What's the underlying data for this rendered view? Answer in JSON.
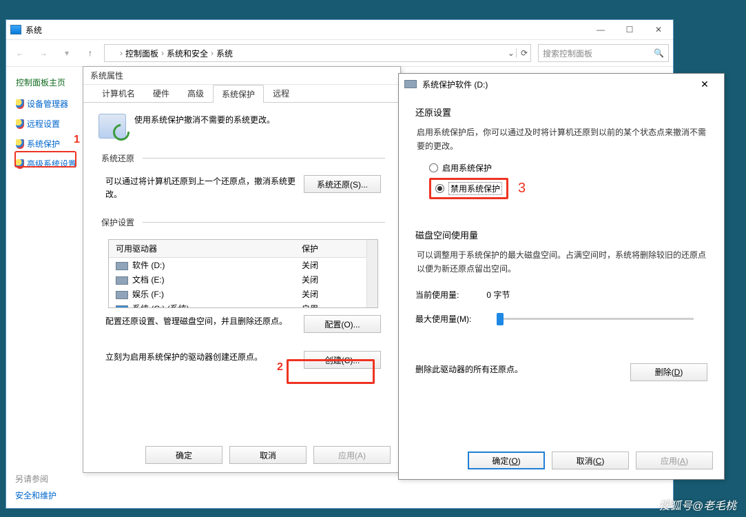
{
  "syswin": {
    "title": "系统",
    "breadcrumb": {
      "root": "控制面板",
      "cat": "系统和安全",
      "page": "系统"
    },
    "search_placeholder": "搜索控制面板",
    "left_heading": "控制面板主页",
    "links": {
      "devmgr": "设备管理器",
      "remote": "远程设置",
      "sysprot": "系统保护",
      "advanced": "高级系统设置"
    },
    "seealso": "另请参阅",
    "security": "安全和维护"
  },
  "annotations": {
    "a1": "1",
    "a2": "2",
    "a3": "3"
  },
  "propdlg": {
    "title": "系统属性",
    "tabs": {
      "computer": "计算机名",
      "hardware": "硬件",
      "advanced": "高级",
      "sysprot": "系统保护",
      "remote": "远程"
    },
    "intro": "使用系统保护撤消不需要的系统更改。",
    "grp_restore": "系统还原",
    "restore_text": "可以通过将计算机还原到上一个还原点，撤消系统更改。",
    "btn_restore": "系统还原(S)...",
    "grp_settings": "保护设置",
    "table": {
      "col_drive": "可用驱动器",
      "col_status": "保护",
      "rows": [
        {
          "name": "软件 (D:)",
          "status": "关闭"
        },
        {
          "name": "文档 (E:)",
          "status": "关闭"
        },
        {
          "name": "娱乐 (F:)",
          "status": "关闭"
        },
        {
          "name": "系统 (C:) (系统)",
          "status": "启用"
        }
      ]
    },
    "config_text": "配置还原设置、管理磁盘空间，并且删除还原点。",
    "btn_config": "配置(O)...",
    "create_text": "立刻为启用系统保护的驱动器创建还原点。",
    "btn_create": "创建(C)...",
    "btn_ok": "确定",
    "btn_cancel": "取消",
    "btn_apply": "应用(A)"
  },
  "subdlg": {
    "title": "系统保护软件 (D:)",
    "h_restore": "还原设置",
    "restore_text": "启用系统保护后，你可以通过及时将计算机还原到以前的某个状态点来撤消不需要的更改。",
    "radio_enable": "启用系统保护",
    "radio_disable": "禁用系统保护",
    "h_usage": "磁盘空间使用量",
    "usage_text": "可以调整用于系统保护的最大磁盘空间。占满空间时，系统将删除较旧的还原点以便为新还原点留出空间。",
    "cur_label": "当前使用量:",
    "cur_val": "0 字节",
    "max_label": "最大使用量(M):",
    "delete_text": "删除此驱动器的所有还原点。",
    "btn_delete": "删除(D)",
    "btn_ok": "确定(O)",
    "btn_cancel": "取消(C)",
    "btn_apply": "应用(A)"
  },
  "watermark": "搜狐号@老毛桃"
}
